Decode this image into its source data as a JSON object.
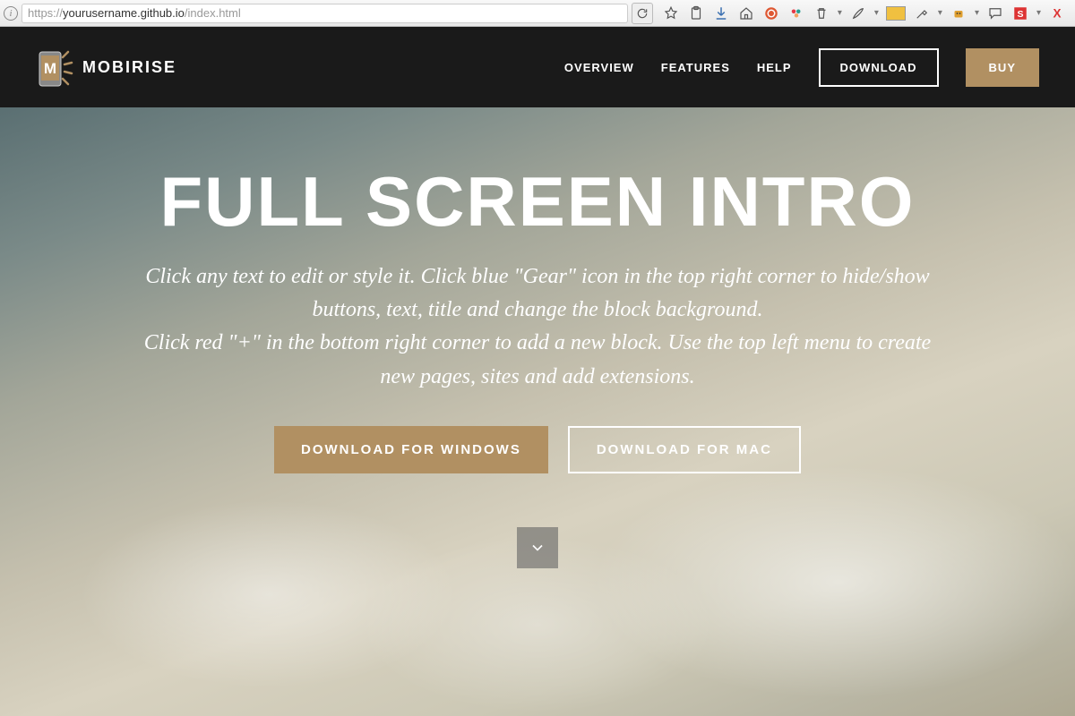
{
  "browser": {
    "url_prefix": "https://",
    "url_main": "yourusername.github.io",
    "url_suffix": "/index.html"
  },
  "header": {
    "brand": "MOBIRISE",
    "logo_letter": "M",
    "nav": {
      "overview": "OVERVIEW",
      "features": "FEATURES",
      "help": "HELP",
      "download": "DOWNLOAD",
      "buy": "BUY"
    }
  },
  "hero": {
    "title": "FULL SCREEN INTRO",
    "paragraph": "Click any text to edit or style it. Click blue \"Gear\" icon in the top right corner to hide/show buttons, text, title and change the block background.\nClick red \"+\" in the bottom right corner to add a new block. Use the top left menu to create new pages, sites and add extensions.",
    "button_windows": "DOWNLOAD FOR WINDOWS",
    "button_mac": "DOWNLOAD FOR MAC"
  },
  "colors": {
    "accent": "#b19062",
    "header_bg": "#1a1a1a"
  }
}
